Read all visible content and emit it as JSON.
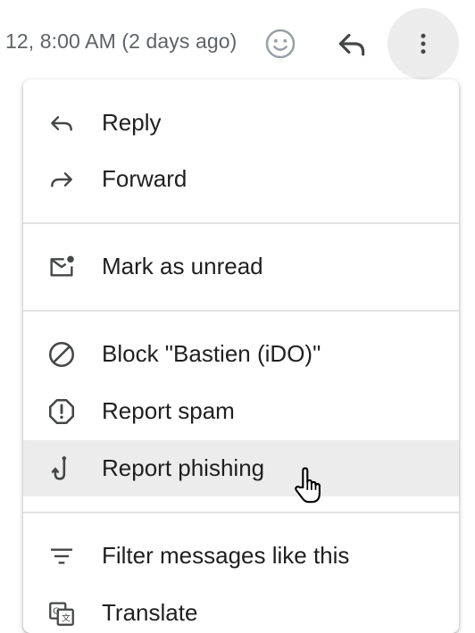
{
  "header": {
    "timestamp": "12, 8:00 AM (2 days ago)",
    "icons": [
      "emoji-icon",
      "reply-icon",
      "more-vert-icon"
    ]
  },
  "menu": {
    "items": [
      {
        "label": "Reply",
        "icon": "reply-icon"
      },
      {
        "label": "Forward",
        "icon": "forward-icon"
      },
      {
        "label": "Mark as unread",
        "icon": "mark-unread-icon"
      },
      {
        "label": "Block \"Bastien (iDO)\"",
        "icon": "block-icon"
      },
      {
        "label": "Report spam",
        "icon": "report-spam-icon"
      },
      {
        "label": "Report phishing",
        "icon": "phishing-hook-icon",
        "hovered": true
      },
      {
        "label": "Filter messages like this",
        "icon": "filter-icon"
      },
      {
        "label": "Translate",
        "icon": "translate-icon"
      }
    ]
  },
  "colors": {
    "hover_bg": "#ececec",
    "icon": "#444746",
    "text": "#1f1f1f",
    "muted_text": "#5f6368",
    "divider": "#e3e3e3"
  }
}
